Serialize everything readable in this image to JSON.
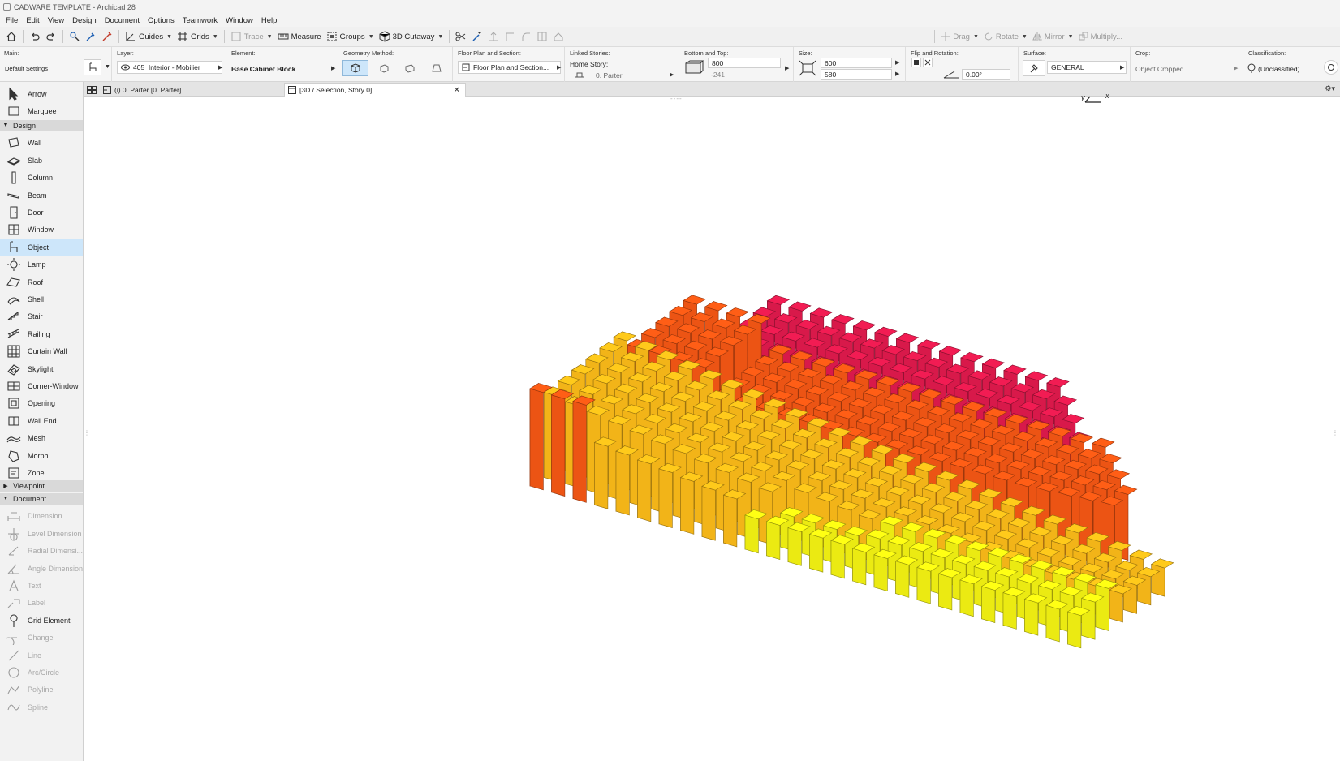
{
  "window": {
    "title": "CADWARE TEMPLATE - Archicad 28"
  },
  "menu": [
    "File",
    "Edit",
    "View",
    "Design",
    "Document",
    "Options",
    "Teamwork",
    "Window",
    "Help"
  ],
  "toolbar": {
    "guides": "Guides",
    "grids": "Grids",
    "trace": "Trace",
    "measure": "Measure",
    "groups": "Groups",
    "cutaway": "3D Cutaway",
    "drag": "Drag",
    "rotate": "Rotate",
    "mirror": "Mirror",
    "multiply": "Multiply..."
  },
  "infobox": {
    "main_label": "Main:",
    "main_value": "Default Settings",
    "layer_label": "Layer:",
    "layer_value": "405_Interior - Mobilier",
    "element_label": "Element:",
    "element_value": "Base Cabinet Block",
    "geometry_label": "Geometry Method:",
    "floorplan_label": "Floor Plan and Section:",
    "floorplan_value": "Floor Plan and Section...",
    "stories_label": "Linked Stories:",
    "home_story_label": "Home Story:",
    "home_story_value": "0. Parter",
    "bottomtop_label": "Bottom and Top:",
    "top_value": "800",
    "bottom_value": "-241",
    "size_label": "Size:",
    "size_a": "600",
    "size_b": "580",
    "flip_label": "Flip and Rotation:",
    "rotation_value": "0.00°",
    "surface_label": "Surface:",
    "surface_value": "GENERAL",
    "crop_label": "Crop:",
    "crop_value": "Object Cropped",
    "class_label": "Classification:",
    "class_value": "(Unclassified)"
  },
  "toolbox": {
    "tools_top": [
      {
        "label": "Arrow",
        "icon": "arrow-icon"
      },
      {
        "label": "Marquee",
        "icon": "marquee-icon"
      }
    ],
    "design_title": "Design",
    "design": [
      {
        "label": "Wall",
        "icon": "wall-icon"
      },
      {
        "label": "Slab",
        "icon": "slab-icon"
      },
      {
        "label": "Column",
        "icon": "column-icon"
      },
      {
        "label": "Beam",
        "icon": "beam-icon"
      },
      {
        "label": "Door",
        "icon": "door-icon"
      },
      {
        "label": "Window",
        "icon": "window-icon"
      },
      {
        "label": "Object",
        "icon": "object-icon",
        "selected": true
      },
      {
        "label": "Lamp",
        "icon": "lamp-icon"
      },
      {
        "label": "Roof",
        "icon": "roof-icon"
      },
      {
        "label": "Shell",
        "icon": "shell-icon"
      },
      {
        "label": "Stair",
        "icon": "stair-icon"
      },
      {
        "label": "Railing",
        "icon": "railing-icon"
      },
      {
        "label": "Curtain Wall",
        "icon": "curtain-wall-icon"
      },
      {
        "label": "Skylight",
        "icon": "skylight-icon"
      },
      {
        "label": "Corner-Window",
        "icon": "corner-window-icon"
      },
      {
        "label": "Opening",
        "icon": "opening-icon"
      },
      {
        "label": "Wall End",
        "icon": "wall-end-icon"
      },
      {
        "label": "Mesh",
        "icon": "mesh-icon"
      },
      {
        "label": "Morph",
        "icon": "morph-icon"
      },
      {
        "label": "Zone",
        "icon": "zone-icon"
      }
    ],
    "viewpoint_title": "Viewpoint",
    "document_title": "Document",
    "document": [
      {
        "label": "Dimension",
        "icon": "dimension-icon",
        "disabled": true
      },
      {
        "label": "Level Dimension",
        "icon": "level-dimension-icon",
        "disabled": true
      },
      {
        "label": "Radial Dimensi...",
        "icon": "radial-dimension-icon",
        "disabled": true
      },
      {
        "label": "Angle Dimension",
        "icon": "angle-dimension-icon",
        "disabled": true
      },
      {
        "label": "Text",
        "icon": "text-icon",
        "disabled": true
      },
      {
        "label": "Label",
        "icon": "label-icon",
        "disabled": true
      },
      {
        "label": "Grid Element",
        "icon": "grid-element-icon",
        "disabled": false
      },
      {
        "label": "Change",
        "icon": "change-icon",
        "disabled": true
      },
      {
        "label": "Line",
        "icon": "line-icon",
        "disabled": true
      },
      {
        "label": "Arc/Circle",
        "icon": "arc-icon",
        "disabled": true
      },
      {
        "label": "Polyline",
        "icon": "polyline-icon",
        "disabled": true
      },
      {
        "label": "Spline",
        "icon": "spline-icon",
        "disabled": true
      }
    ]
  },
  "tabs": [
    {
      "label": "(i) 0. Parter [0. Parter]",
      "active": false
    },
    {
      "label": "[3D / Selection, Story 0]",
      "active": true
    }
  ],
  "viewport": {
    "axis_y": "y",
    "axis_x": "x",
    "colors": {
      "red": "#d8194a",
      "orange": "#ec5414",
      "amber": "#f2b418",
      "yellow": "#ebea12"
    }
  }
}
